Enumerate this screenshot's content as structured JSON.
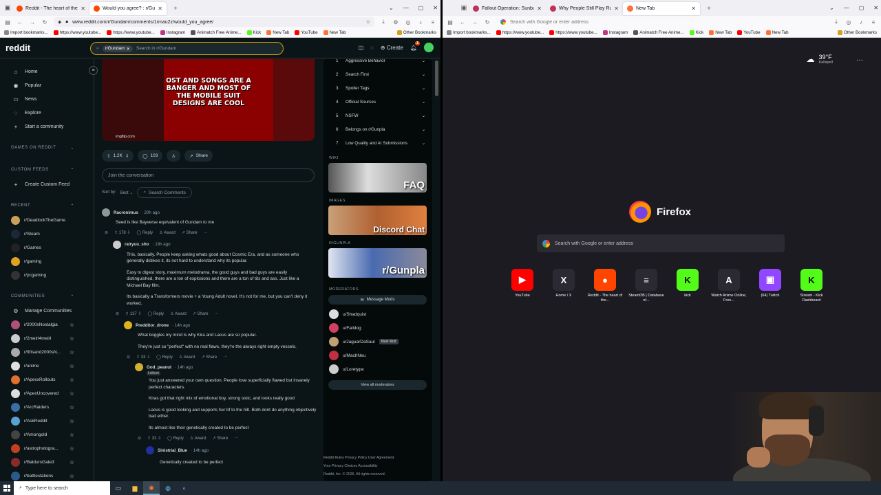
{
  "left_browser": {
    "tabs": [
      {
        "title": "Reddit - The heart of the intern",
        "active": false
      },
      {
        "title": "Would you agree? : r/Gundam",
        "active": true
      }
    ],
    "url": "www.reddit.com/r/Gundam/comments/1rmau2z/would_you_agree/",
    "bookmarks": [
      "Import bookmarks...",
      "https://www.youtube...",
      "https://www.youtube...",
      "Instagram",
      "Animatch Free Anime...",
      "Kick",
      "New Tab",
      "YouTube",
      "New Tab"
    ],
    "other_bookmarks": "Other Bookmarks"
  },
  "reddit": {
    "logo": "reddit",
    "search_chip": "r/Gundam",
    "search_placeholder": "Search in r/Gundam",
    "create": "Create",
    "notif_count": "1",
    "nav": [
      {
        "label": "Home",
        "icon": "home-icon",
        "glyph": "⌂"
      },
      {
        "label": "Popular",
        "icon": "popular-icon",
        "glyph": "◉"
      },
      {
        "label": "News",
        "icon": "news-icon",
        "glyph": "▭"
      },
      {
        "label": "Explore",
        "icon": "explore-icon",
        "glyph": "◌"
      },
      {
        "label": "Start a community",
        "icon": "plus-icon",
        "glyph": "+"
      }
    ],
    "sections": {
      "games": "GAMES ON REDDIT",
      "custom_feeds": "CUSTOM FEEDS",
      "create_feed": "Create Custom Feed",
      "recent": "RECENT",
      "communities": "COMMUNITIES",
      "manage": "Manage Communities"
    },
    "recent": [
      {
        "name": "r/DeadlockTheGame",
        "color": "#c9a15a"
      },
      {
        "name": "r/Steam",
        "color": "#1b2838"
      },
      {
        "name": "r/Games",
        "color": "#222222"
      },
      {
        "name": "r/gaming",
        "color": "#e0a020"
      },
      {
        "name": "r/pcgaming",
        "color": "#333333"
      }
    ],
    "communities": [
      {
        "name": "r/2000sNostalgia",
        "color": "#b0507a"
      },
      {
        "name": "r/2meirl4meirl",
        "color": "#cccccc"
      },
      {
        "name": "r/90sand2000sN...",
        "color": "#aaaaaa"
      },
      {
        "name": "r/anime",
        "color": "#e0e0e0"
      },
      {
        "name": "r/ApexxRollouts",
        "color": "#e07030"
      },
      {
        "name": "r/ApexUncovered",
        "color": "#dddddd"
      },
      {
        "name": "r/ArcRaiders",
        "color": "#3a6ea5"
      },
      {
        "name": "r/AskReddit",
        "color": "#5aa0d0"
      },
      {
        "name": "r/Amongold",
        "color": "#444444"
      },
      {
        "name": "r/astrophotogra...",
        "color": "#c04020"
      },
      {
        "name": "r/BaldursGate3",
        "color": "#8a2a2a"
      },
      {
        "name": "r/battlestations",
        "color": "#2a5a8a"
      }
    ],
    "post": {
      "image_text": "OST AND SONGS ARE A BANGER AND MOST OF THE MOBILE SUIT DESIGNS ARE COOL",
      "watermark": "imgflip.com",
      "votes": "1.2K",
      "comments": "103",
      "share": "Share",
      "join": "Join the conversation",
      "sort_by": "Sort by:",
      "sort_value": "Best",
      "search_comments": "Search Comments"
    },
    "comments": [
      {
        "author": "Racronimus",
        "time": "· 20h ago",
        "body": [
          "Seed is like Bayverse equivalent of Gundam to me"
        ],
        "votes": "178",
        "reply": "Reply",
        "award": "Award",
        "share": "Share",
        "color": "#8a9a9a"
      },
      {
        "author": "rairyuu_sho",
        "time": "· 19h ago",
        "body": [
          "This, basically. People keep asking whats good about Cosmic Era, and as someone who generally dislikes it, its not hard to understand why its popular.",
          "Easy to digest story, maximum melodrama, the good guys and bad guys are easily distinguished, there are a ton of explosions and there are a ton of tits and ass. Just like a Michael Bay film.",
          "Its basically a Transformers movie + a Young Adult novel. It's not for me, but you can't deny it worked."
        ],
        "votes": "137",
        "reply": "Reply",
        "award": "Award",
        "share": "Share",
        "color": "#cccccc"
      },
      {
        "author": "Predditor_drone",
        "time": "· 14h ago",
        "body": [
          "What boggles my mind is why Kira and Lacus are so popular.",
          "They're just so \"perfect\" with no real flaws, they're the always right empty vessels."
        ],
        "votes": "33",
        "reply": "Reply",
        "award": "Award",
        "share": "Share",
        "color": "#e0b020"
      },
      {
        "author": "God_peanut",
        "flair": "Lolicon",
        "time": "· 14h ago",
        "body": [
          "You just answered your own question. People love superficially flawed but insanely perfect characters.",
          "Kiras got that right mix of emotional boy, strong stoic, and looks really good",
          "Lacus is good looking and supports her bf to the hilt. Both dont do anything objectively bad either.",
          "Its almost like their genetically created to be perfect"
        ],
        "votes": "32",
        "reply": "Reply",
        "award": "Award",
        "share": "Share",
        "color": "#d0b030"
      },
      {
        "author": "Sinistrial_Blue",
        "time": "· 14h ago",
        "body": [
          "Genetically created to be perfect"
        ],
        "color": "#2030a0"
      }
    ],
    "rules": [
      {
        "n": "1",
        "t": "Aggressive Behavior"
      },
      {
        "n": "2",
        "t": "Search First"
      },
      {
        "n": "3",
        "t": "Spoiler Tags"
      },
      {
        "n": "4",
        "t": "Official Sources"
      },
      {
        "n": "5",
        "t": "NSFW"
      },
      {
        "n": "6",
        "t": "Belongs on r/Gunpla"
      },
      {
        "n": "7",
        "t": "Low Quality and AI Submissions"
      }
    ],
    "widgets": [
      {
        "label": "WIKI",
        "text": "FAQ",
        "color": "#aaaaaa"
      },
      {
        "label": "IMAGES",
        "text": "Discord Chat",
        "color": "#c06030"
      },
      {
        "label": "R/GUNPLA",
        "text": "r/Gunpla",
        "color": "#4a6ab0"
      }
    ],
    "moderators_label": "MODERATORS",
    "message_mods": "Message Mods",
    "mods": [
      {
        "name": "u/Shadquist",
        "badge": "",
        "color": "#dddddd"
      },
      {
        "name": "u/Falldog",
        "badge": "",
        "color": "#d04060"
      },
      {
        "name": "u/JaguarDaSaul",
        "badge": "Main Mod",
        "color": "#c0a070"
      },
      {
        "name": "u/MachNeu",
        "badge": "",
        "color": "#c03040"
      },
      {
        "name": "u/Loretype",
        "badge": "",
        "color": "#cccccc"
      }
    ],
    "view_all": "View all moderators",
    "footer": {
      "links1": "Reddit Rules   Privacy Policy   User Agreement",
      "links2": "Your Privacy Choices   Accessibility",
      "copy": "Reddit, Inc. © 2026. All rights reserved."
    }
  },
  "right_browser": {
    "tabs": [
      {
        "title": "Fallout Operation: Sunburst (Fa",
        "active": false
      },
      {
        "title": "Why People Still Play Runescap",
        "active": false
      },
      {
        "title": "New Tab",
        "active": true
      }
    ],
    "url_placeholder": "Search with Google or enter address",
    "bookmarks": [
      "Import bookmarks...",
      "https://www.youtube...",
      "https://www.youtube...",
      "Instagram",
      "Animatch Free Anime...",
      "Kick",
      "New Tab",
      "YouTube",
      "New Tab"
    ],
    "other_bookmarks": "Other Bookmarks",
    "weather_temp": "39°F",
    "weather_loc": "Kalispell",
    "brand": "Firefox",
    "search_placeholder": "Search with Google or enter address",
    "shortcuts": [
      {
        "label": "YouTube",
        "glyph": "▶",
        "color": "#ff0000",
        "fg": "#ffffff"
      },
      {
        "label": "Home / X",
        "glyph": "X",
        "color": "#2b2a33",
        "fg": "#ffffff"
      },
      {
        "label": "Reddit - The heart of the...",
        "glyph": "●",
        "color": "#ff4500",
        "fg": "#ffffff"
      },
      {
        "label": "SteamDB | Database of...",
        "glyph": "≡",
        "color": "#2b2a33",
        "fg": "#ffffff"
      },
      {
        "label": "kick",
        "glyph": "K",
        "color": "#53fc18",
        "fg": "#000000"
      },
      {
        "label": "Watch Anime Online, Free...",
        "glyph": "A",
        "color": "#2b2a33",
        "fg": "#ffffff"
      },
      {
        "label": "(64) Twitch",
        "glyph": "▣",
        "color": "#9146ff",
        "fg": "#ffffff"
      },
      {
        "label": "Stream - Kick Dashboard",
        "glyph": "K",
        "color": "#53fc18",
        "fg": "#000000"
      }
    ]
  },
  "taskbar": {
    "search": "Type here to search"
  }
}
